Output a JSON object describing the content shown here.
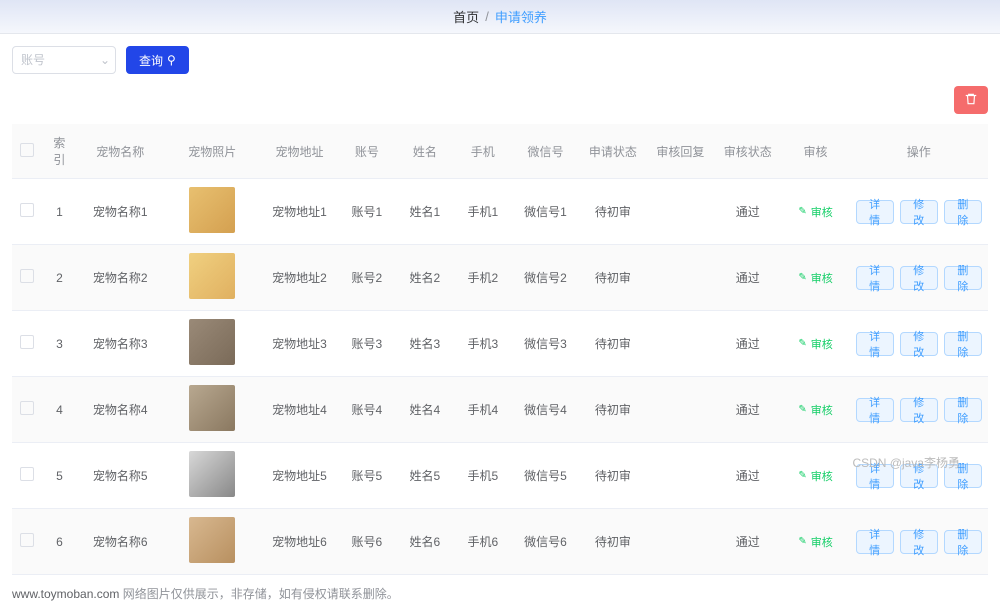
{
  "breadcrumb": {
    "home": "首页",
    "current": "申请领养"
  },
  "toolbar": {
    "search_placeholder": "账号",
    "search_btn": "查询"
  },
  "table": {
    "headers": {
      "index": "索引",
      "pet_name": "宠物名称",
      "pet_img": "宠物照片",
      "pet_addr": "宠物地址",
      "account": "账号",
      "username": "姓名",
      "phone": "手机",
      "wechat": "微信号",
      "apply_status": "申请状态",
      "audit_reply": "审核回复",
      "audit_status": "审核状态",
      "audit": "审核",
      "ops": "操作"
    },
    "audit_label": "审核",
    "ops_labels": {
      "detail": "详情",
      "edit": "修改",
      "delete": "删除"
    },
    "rows": [
      {
        "idx": "1",
        "pet_name": "宠物名称1",
        "pet_addr": "宠物地址1",
        "account": "账号1",
        "username": "姓名1",
        "phone": "手机1",
        "wechat": "微信号1",
        "apply_status": "待初审",
        "audit_reply": "",
        "audit_status": "通过"
      },
      {
        "idx": "2",
        "pet_name": "宠物名称2",
        "pet_addr": "宠物地址2",
        "account": "账号2",
        "username": "姓名2",
        "phone": "手机2",
        "wechat": "微信号2",
        "apply_status": "待初审",
        "audit_reply": "",
        "audit_status": "通过"
      },
      {
        "idx": "3",
        "pet_name": "宠物名称3",
        "pet_addr": "宠物地址3",
        "account": "账号3",
        "username": "姓名3",
        "phone": "手机3",
        "wechat": "微信号3",
        "apply_status": "待初审",
        "audit_reply": "",
        "audit_status": "通过"
      },
      {
        "idx": "4",
        "pet_name": "宠物名称4",
        "pet_addr": "宠物地址4",
        "account": "账号4",
        "username": "姓名4",
        "phone": "手机4",
        "wechat": "微信号4",
        "apply_status": "待初审",
        "audit_reply": "",
        "audit_status": "通过"
      },
      {
        "idx": "5",
        "pet_name": "宠物名称5",
        "pet_addr": "宠物地址5",
        "account": "账号5",
        "username": "姓名5",
        "phone": "手机5",
        "wechat": "微信号5",
        "apply_status": "待初审",
        "audit_reply": "",
        "audit_status": "通过"
      },
      {
        "idx": "6",
        "pet_name": "宠物名称6",
        "pet_addr": "宠物地址6",
        "account": "账号6",
        "username": "姓名6",
        "phone": "手机6",
        "wechat": "微信号6",
        "apply_status": "待初审",
        "audit_reply": "",
        "audit_status": "通过"
      }
    ]
  },
  "footer": {
    "domain": "www.toymoban.com",
    "note": " 网络图片仅供展示，非存储，如有侵权请联系删除。"
  },
  "watermark": "CSDN @java李杨勇"
}
